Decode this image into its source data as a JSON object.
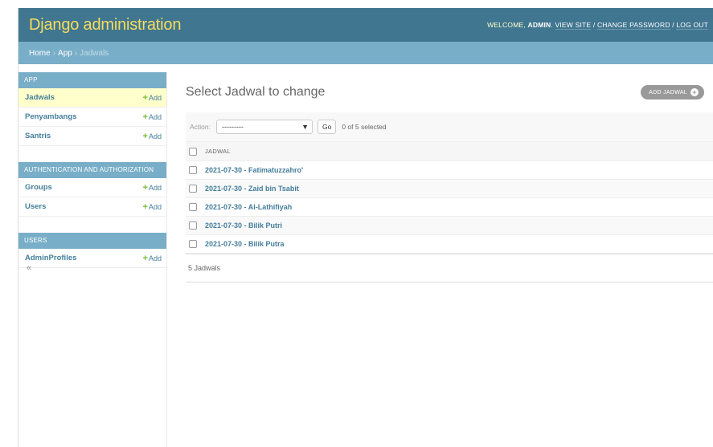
{
  "header": {
    "brand": "Django administration",
    "welcome": "WELCOME,",
    "username": "ADMIN",
    "view_site": "VIEW SITE",
    "change_password": "CHANGE PASSWORD",
    "logout": "LOG OUT",
    "separator": "/"
  },
  "breadcrumbs": {
    "home": "Home",
    "app": "App",
    "current": "Jadwals",
    "separator": "›"
  },
  "sidebar": {
    "add_label": "Add",
    "collapse_glyph": "«",
    "modules": [
      {
        "caption": "APP",
        "rows": [
          {
            "label": "Jadwals"
          },
          {
            "label": "Penyambangs"
          },
          {
            "label": "Santris"
          }
        ]
      },
      {
        "caption": "AUTHENTICATION AND AUTHORIZATION",
        "rows": [
          {
            "label": "Groups"
          },
          {
            "label": "Users"
          }
        ]
      },
      {
        "caption": "USERS",
        "rows": [
          {
            "label": "AdminProfiles"
          }
        ]
      }
    ]
  },
  "content": {
    "title": "Select Jadwal to change",
    "add_button": "ADD JADWAL",
    "actions": {
      "label": "Action:",
      "selected_value": "---------",
      "go": "Go",
      "selection_count": "0 of 5 selected"
    },
    "table": {
      "column": "JADWAL",
      "rows": [
        "2021-07-30 - Fatimatuzzahro'",
        "2021-07-30 - Zaid bin Tsabit",
        "2021-07-30 - Al-Lathifiyah",
        "2021-07-30 - Bilik Putri",
        "2021-07-30 - Bilik Putra"
      ]
    },
    "paginator": "5 Jadwals"
  },
  "colors": {
    "header_bg": "#417690",
    "brand": "#f5dd5d",
    "breadcrumb_bg": "#79aec8",
    "link": "#447e9b",
    "add_plus": "#70bf2b",
    "current_row": "#ffffcc"
  }
}
